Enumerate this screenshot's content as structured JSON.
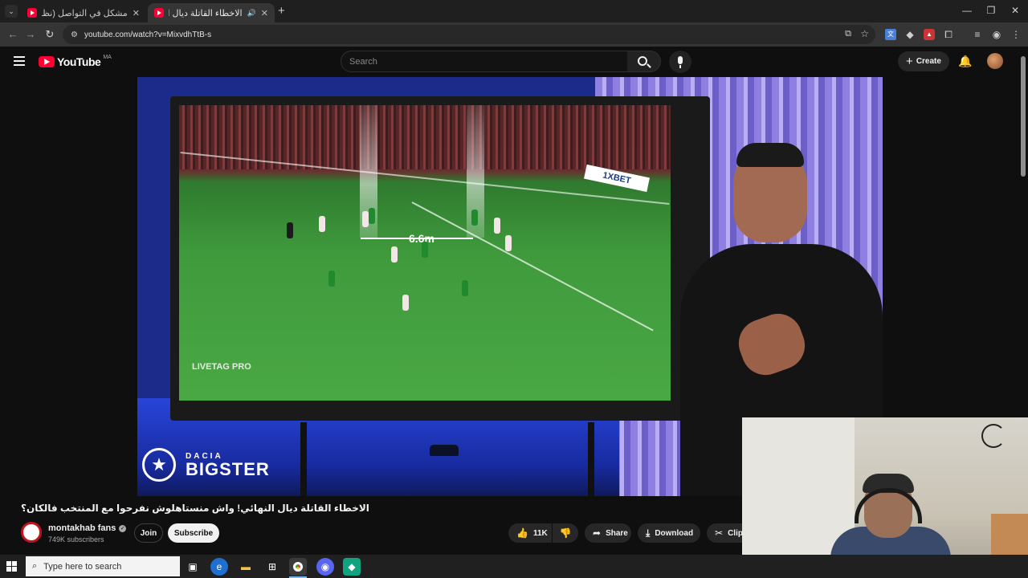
{
  "browser": {
    "tabs": [
      {
        "title": "مشكل في التواصل (نظرية البراك..."
      },
      {
        "title": "الاخطاء القاتلة ديال النهائي! و..."
      }
    ],
    "url": "youtube.com/watch?v=MixvdhTtB-s"
  },
  "youtube": {
    "logo_text": "YouTube",
    "region": "MA",
    "search_placeholder": "Search",
    "create_label": "Create"
  },
  "video": {
    "distance_label": "6.6m",
    "broadcast_tag": "LIVETAG PRO",
    "sponsor_brand": "DACIA",
    "sponsor_model": "BIGSTER",
    "board_ad": "1XBET",
    "title": "الاخطاء القاتلة ديال النهائي! واش منستاهلوش نفرحوا مع المنتخب فالكان؟"
  },
  "channel": {
    "name": "montakhab fans",
    "subscribers": "749K subscribers",
    "join_label": "Join",
    "subscribe_label": "Subscribe"
  },
  "actions": {
    "likes": "11K",
    "share_label": "Share",
    "download_label": "Download",
    "clip_label": "Clip"
  },
  "taskbar": {
    "search_placeholder": "Type here to search"
  },
  "colors": {
    "youtube_red": "#ff0033",
    "page_bg": "#0f0f0f",
    "pill_bg": "#272727"
  }
}
